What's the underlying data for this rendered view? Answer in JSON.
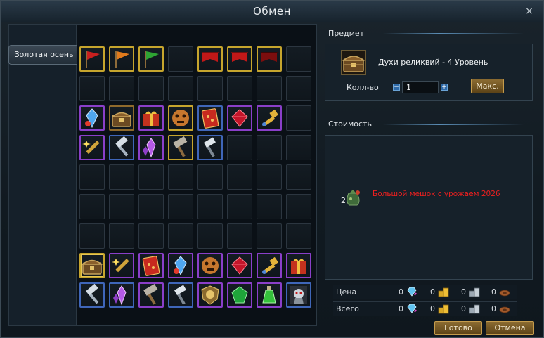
{
  "window": {
    "title": "Обмен"
  },
  "tabs": [
    {
      "label": "Золотая осень"
    }
  ],
  "grid": {
    "cols": 8,
    "rows": 9,
    "items": [
      {
        "slot": 0,
        "icon": "red-flag-icon",
        "rarity": "gold"
      },
      {
        "slot": 1,
        "icon": "orange-flag-icon",
        "rarity": "gold"
      },
      {
        "slot": 2,
        "icon": "green-flag-icon",
        "rarity": "gold"
      },
      {
        "slot": 4,
        "icon": "red-banner-icon",
        "rarity": "gold"
      },
      {
        "slot": 5,
        "icon": "red-banner-icon",
        "rarity": "gold"
      },
      {
        "slot": 6,
        "icon": "dark-red-banner-icon",
        "rarity": "gold"
      },
      {
        "slot": 16,
        "icon": "blue-crystal-icon",
        "rarity": "purple"
      },
      {
        "slot": 17,
        "icon": "treasure-chest-icon",
        "rarity": "brown"
      },
      {
        "slot": 18,
        "icon": "red-gift-box-icon",
        "rarity": "purple"
      },
      {
        "slot": 19,
        "icon": "beast-mask-icon",
        "rarity": "gold"
      },
      {
        "slot": 20,
        "icon": "red-card-icon",
        "rarity": "blue"
      },
      {
        "slot": 21,
        "icon": "red-gem-icon",
        "rarity": "purple"
      },
      {
        "slot": 22,
        "icon": "golden-key-icon",
        "rarity": "purple"
      },
      {
        "slot": 24,
        "icon": "sparkle-scroll-icon",
        "rarity": "purple"
      },
      {
        "slot": 25,
        "icon": "silver-hammer-icon",
        "rarity": "blue"
      },
      {
        "slot": 26,
        "icon": "purple-crystal-icon",
        "rarity": "purple"
      },
      {
        "slot": 27,
        "icon": "stone-hammer-icon",
        "rarity": "gold"
      },
      {
        "slot": 28,
        "icon": "steel-hammer-icon",
        "rarity": "blue"
      },
      {
        "slot": 56,
        "icon": "treasure-chest-icon",
        "rarity": "gold",
        "selected": true
      },
      {
        "slot": 57,
        "icon": "sparkle-scroll-icon",
        "rarity": "purple"
      },
      {
        "slot": 58,
        "icon": "red-card-icon",
        "rarity": "purple"
      },
      {
        "slot": 59,
        "icon": "blue-crystal-icon",
        "rarity": "purple"
      },
      {
        "slot": 60,
        "icon": "beast-mask-icon",
        "rarity": "purple"
      },
      {
        "slot": 61,
        "icon": "red-gem-icon",
        "rarity": "purple"
      },
      {
        "slot": 62,
        "icon": "golden-key-icon",
        "rarity": "purple"
      },
      {
        "slot": 63,
        "icon": "red-gift-box-icon",
        "rarity": "purple"
      },
      {
        "slot": 64,
        "icon": "silver-hammer-icon",
        "rarity": "blue"
      },
      {
        "slot": 65,
        "icon": "purple-crystal-icon",
        "rarity": "blue"
      },
      {
        "slot": 66,
        "icon": "stone-hammer-icon",
        "rarity": "purple"
      },
      {
        "slot": 67,
        "icon": "steel-hammer-icon",
        "rarity": "blue"
      },
      {
        "slot": 68,
        "icon": "lion-crest-icon",
        "rarity": "purple"
      },
      {
        "slot": 69,
        "icon": "green-emerald-icon",
        "rarity": "purple"
      },
      {
        "slot": 70,
        "icon": "green-potion-icon",
        "rarity": "purple"
      },
      {
        "slot": 71,
        "icon": "undead-portrait-icon",
        "rarity": "blue"
      }
    ]
  },
  "item_section": {
    "header": "Предмет",
    "name": "Духи реликвий - 4 Уровень",
    "icon": "treasure-chest-icon",
    "qty_label": "Колл-во",
    "qty_value": "1",
    "max_label": "Макс."
  },
  "cost_section": {
    "header": "Стоимость",
    "reward_count": "2",
    "reward_name": "Большой мешок с урожаем 2026",
    "reward_icon": "harvest-bag-icon"
  },
  "currency": {
    "price_label": "Цена",
    "total_label": "Всего",
    "price": [
      "0",
      "0",
      "0",
      "0"
    ],
    "total": [
      "0",
      "0",
      "0",
      "0"
    ],
    "icons": [
      "diamond-icon",
      "gold-coins-icon",
      "silver-coins-icon",
      "copper-coin-icon"
    ]
  },
  "buttons": {
    "done": "Готово",
    "cancel": "Отмена",
    "close": "×"
  }
}
